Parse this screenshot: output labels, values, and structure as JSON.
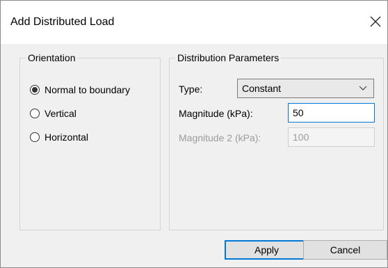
{
  "dialog": {
    "title": "Add Distributed Load"
  },
  "orientation": {
    "legend": "Orientation",
    "options": [
      {
        "label": "Normal to boundary",
        "selected": true
      },
      {
        "label": "Vertical",
        "selected": false
      },
      {
        "label": "Horizontal",
        "selected": false
      }
    ]
  },
  "distribution": {
    "legend": "Distribution Parameters",
    "type_label": "Type:",
    "type_value": "Constant",
    "magnitude_label": "Magnitude (kPa):",
    "magnitude_value": "50",
    "magnitude2_label": "Magnitude 2 (kPa):",
    "magnitude2_value": "100"
  },
  "buttons": {
    "apply": "Apply",
    "cancel": "Cancel"
  },
  "icons": {
    "close": "close-icon",
    "dropdown": "chevron-down-icon"
  }
}
